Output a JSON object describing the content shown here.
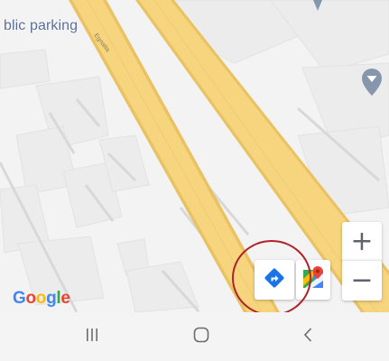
{
  "map": {
    "place_label": "blic parking",
    "street_label": "Egnatia"
  },
  "controls": {
    "zoom_in_label": "+",
    "zoom_out_label": "−",
    "directions_icon": "directions-icon",
    "maps_app_icon": "google-maps-icon"
  },
  "logo": {
    "text": "Google",
    "letter_colors": [
      "#4285f4",
      "#ea4335",
      "#fbbc05",
      "#4285f4",
      "#34a853",
      "#ea4335"
    ]
  },
  "nav": {
    "recents_icon": "recents-icon",
    "home_icon": "home-icon",
    "back_icon": "back-icon"
  },
  "colors": {
    "road_fill": "#f7d57e",
    "road_edge": "#e9c264",
    "highlight_circle": "#b0232a",
    "directions_blue": "#1a73e8",
    "poi_marker": "#8697ad"
  }
}
